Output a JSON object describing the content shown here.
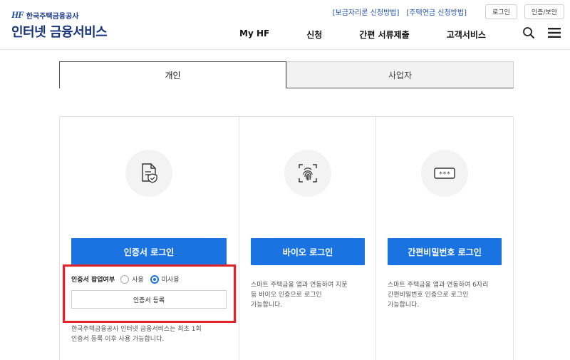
{
  "header": {
    "logo_mark": "HF",
    "logo_org": "한국주택금융공사",
    "logo_service": "인터넷 금융서비스",
    "util_links": [
      "[보금자리론 신청방법]",
      "[주택연금 신청방법]"
    ],
    "login_label": "로그인",
    "security_label": "인증/보안",
    "gnb": [
      "My HF",
      "신청",
      "간편 서류제출",
      "고객서비스"
    ],
    "search_icon": "search-icon",
    "menu_icon": "hamburger-menu-icon"
  },
  "tabs": [
    {
      "label": "개인",
      "active": true
    },
    {
      "label": "사업자",
      "active": false
    }
  ],
  "panels": {
    "certificate": {
      "icon": "certificate-document-icon",
      "button_label": "인증서 로그인",
      "usage_label": "인증서 팝업여부",
      "option_use": "사용",
      "option_nouse": "미사용",
      "selected": "미사용",
      "register_label": "인증서 등록",
      "desc_line1": "한국주택금융공사 인터넷 금융서비스는 최초 1회",
      "desc_line2": "인증서 등록 이후 사용 가능합니다."
    },
    "bio": {
      "icon": "fingerprint-icon",
      "button_label": "바이오 로그인",
      "desc_line1": "스마트 주택금융 앱과 연동하여 지문",
      "desc_line2": "등 바이오 인증으로 로그인",
      "desc_line3": "가능합니다."
    },
    "pin": {
      "icon": "password-box-icon",
      "icon_text": "***",
      "button_label": "간편비밀번호 로그인",
      "desc_line1": "스마트 주택금융 앱과 연동하여 6자리",
      "desc_line2": "간편비밀번호 인증으로 로그인",
      "desc_line3": "가능합니다."
    }
  },
  "colors": {
    "primary": "#1a73e0",
    "brand": "#17357c",
    "highlight": "#e0242a"
  }
}
